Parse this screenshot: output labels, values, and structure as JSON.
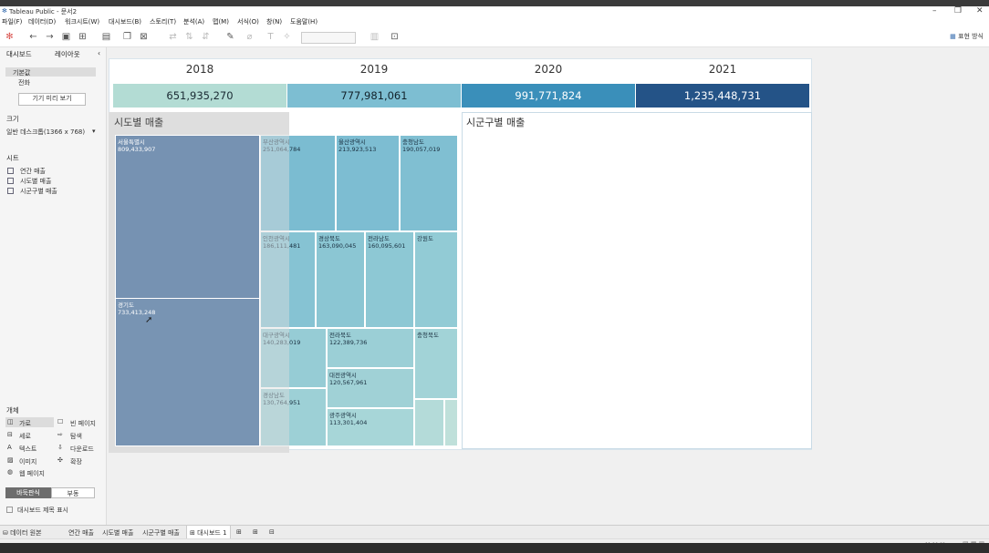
{
  "window": {
    "title": "Tableau Public - 문서2"
  },
  "menu": [
    "파일(F)",
    "데이터(D)",
    "워크시트(W)",
    "대시보드(B)",
    "스토리(T)",
    "분석(A)",
    "맵(M)",
    "서식(O)",
    "창(N)",
    "도움말(H)"
  ],
  "toolbar": {
    "show_me": "표현 방식"
  },
  "side": {
    "tab_dashboard": "대시보드",
    "tab_layout": "레이아웃",
    "device_default": "기본값",
    "device_phone": "전화",
    "preview_btn": "기기 미리 보기",
    "size_head": "크기",
    "size_value": "일반 데스크톱(1366 x 768)",
    "sheets_head": "시트",
    "sheets": [
      "연간 매출",
      "시도별 매출",
      "시군구별 매출"
    ],
    "objects_head": "개체",
    "objects": [
      "가로",
      "빈 페이지",
      "세로",
      "탐색",
      "텍스트",
      "다운로드",
      "이미지",
      "확장",
      "웹 페이지"
    ],
    "tiled": "바둑판식",
    "floating": "부동",
    "show_title": "대시보드 제목 표시"
  },
  "years": [
    "2018",
    "2019",
    "2020",
    "2021"
  ],
  "annual_sales": [
    "651,935,270",
    "777,981,061",
    "991,771,824",
    "1,235,448,731"
  ],
  "annual_colors": [
    "#b3dcd4",
    "#7dbed2",
    "#3a8fba",
    "#245387"
  ],
  "titles": {
    "sido": "시도별 매출",
    "sigungu": "시군구별 매출"
  },
  "treemap": {
    "seoul": {
      "name": "서울특별시",
      "value": "809,433,907"
    },
    "gyeonggi": {
      "name": "경기도",
      "value": "733,413,248"
    },
    "busan": {
      "name": "부산광역시",
      "value": "251,064,784"
    },
    "ulsan": {
      "name": "울산광역시",
      "value": "213,923,513"
    },
    "chungnam": {
      "name": "충청남도",
      "value": "190,057,019"
    },
    "incheon": {
      "name": "인천광역시",
      "value": "186,111,481"
    },
    "gyeongbuk": {
      "name": "경상북도",
      "value": "163,090,045"
    },
    "jeonnam": {
      "name": "전라남도",
      "value": "160,095,601"
    },
    "gangwon": {
      "name": "강원도"
    },
    "daegu": {
      "name": "대구광역시",
      "value": "140,283,019"
    },
    "jeonbuk": {
      "name": "전라북도",
      "value": "122,389,736"
    },
    "chungbuk": {
      "name": "충청북도"
    },
    "daejeon": {
      "name": "대전광역시",
      "value": "120,567,961"
    },
    "gyeongnam": {
      "name": "경상남도",
      "value": "130,764,951"
    },
    "gwangju": {
      "name": "광주광역시",
      "value": "113,301,404"
    }
  },
  "tabs": {
    "datasource": "데이터 원본",
    "t1": "연간 매출",
    "t2": "시도별 매출",
    "t3": "시군구별 매출",
    "t4": "대시보드 1"
  }
}
